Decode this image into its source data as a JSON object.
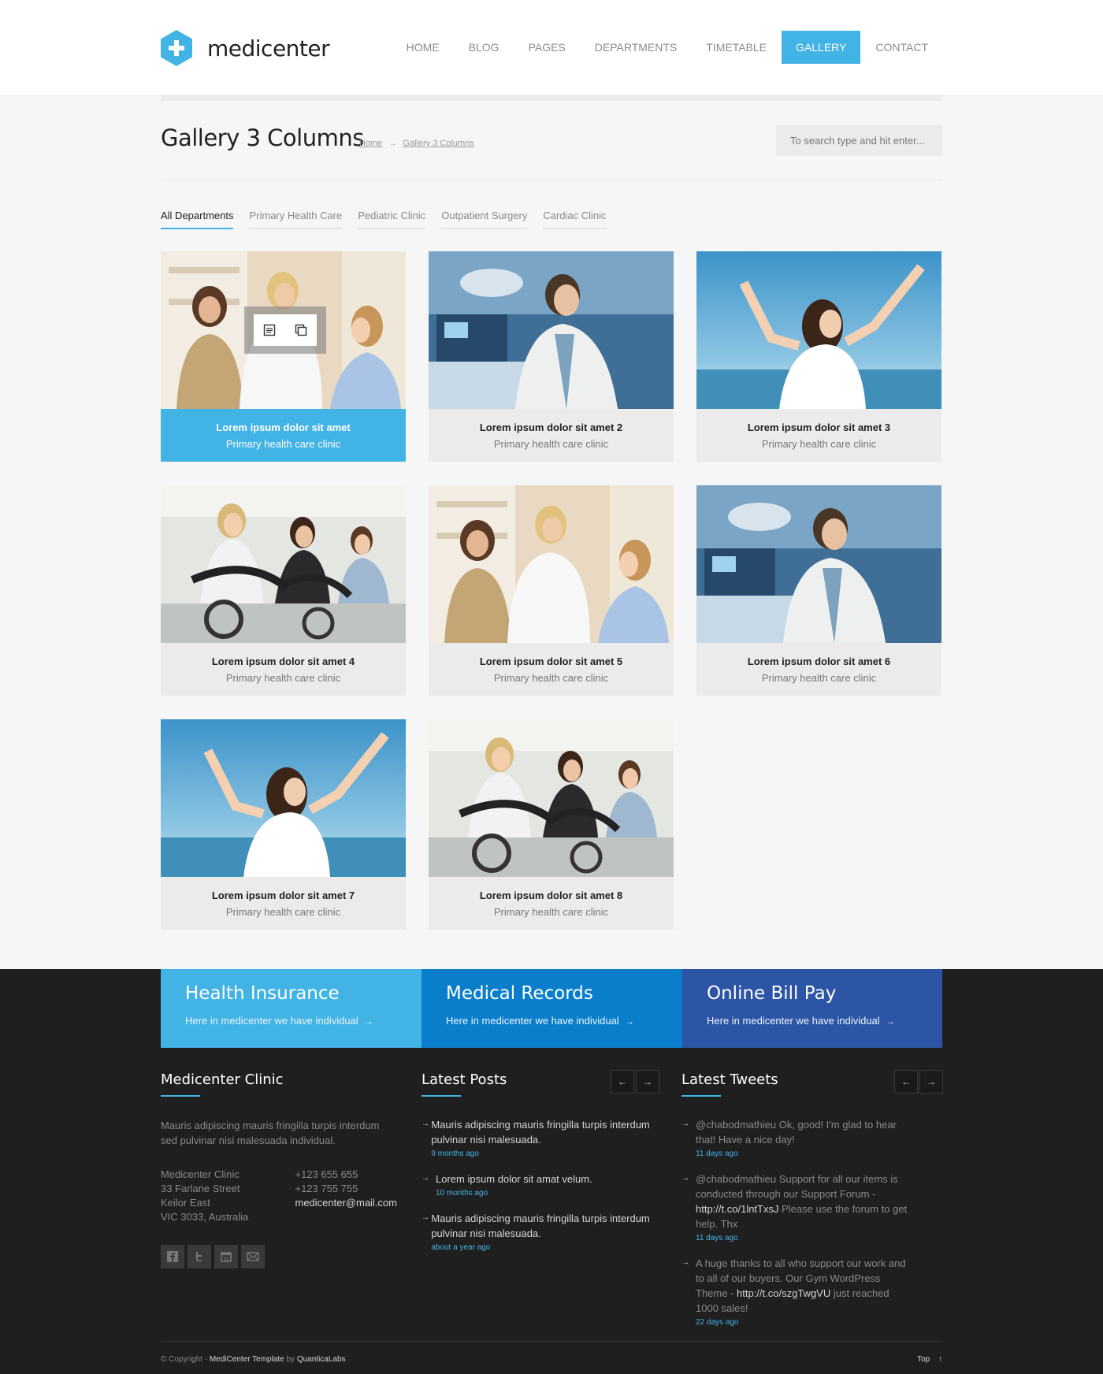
{
  "brand": {
    "name": "medicenter",
    "accent": "#42b3e5"
  },
  "nav": [
    "HOME",
    "BLOG",
    "PAGES",
    "DEPARTMENTS",
    "TIMETABLE",
    "GALLERY",
    "CONTACT"
  ],
  "nav_active": "GALLERY",
  "page": {
    "title": "Gallery 3 Columns",
    "breadcrumb": {
      "home": "Home",
      "sep": "→",
      "current": "Gallery 3 Columns"
    },
    "search_placeholder": "To search type and hit enter..."
  },
  "filters": [
    "All Departments",
    "Primary Health Care",
    "Pediatric Clinic",
    "Outpatient Surgery",
    "Cardiac Clinic"
  ],
  "filter_active": "All Departments",
  "gallery": [
    {
      "title": "Lorem ipsum dolor sit amet",
      "subtitle": "Primary health care clinic",
      "image": "doctor-child"
    },
    {
      "title": "Lorem ipsum dolor sit amet 2",
      "subtitle": "Primary health care clinic",
      "image": "surgeon"
    },
    {
      "title": "Lorem ipsum dolor sit amet 3",
      "subtitle": "Primary health care clinic",
      "image": "woman-sky"
    },
    {
      "title": "Lorem ipsum dolor sit amet 4",
      "subtitle": "Primary health care clinic",
      "image": "spinning"
    },
    {
      "title": "Lorem ipsum dolor sit amet 5",
      "subtitle": "Primary health care clinic",
      "image": "doctor-child"
    },
    {
      "title": "Lorem ipsum dolor sit amet 6",
      "subtitle": "Primary health care clinic",
      "image": "surgeon"
    },
    {
      "title": "Lorem ipsum dolor sit amet 7",
      "subtitle": "Primary health care clinic",
      "image": "woman-sky"
    },
    {
      "title": "Lorem ipsum dolor sit amet 8",
      "subtitle": "Primary health care clinic",
      "image": "spinning"
    }
  ],
  "footer": {
    "boxes": [
      {
        "title": "Health Insurance",
        "link": "Here in medicenter we have individual",
        "color": "#42b3e5"
      },
      {
        "title": "Medical Records",
        "link": "Here in medicenter we have individual",
        "color": "#0a7ecb"
      },
      {
        "title": "Online Bill Pay",
        "link": "Here in medicenter we have individual",
        "color": "#2d55a5"
      }
    ],
    "about": {
      "title": "Medicenter Clinic",
      "text": "Mauris adipiscing mauris fringilla turpis interdum sed pulvinar nisi malesuada individual.",
      "address": [
        "Medicenter Clinic",
        "33 Farlane Street",
        "Keilor East",
        "VIC 3033, Australia"
      ],
      "phones": [
        "+123 655 655",
        "+123 755 755"
      ],
      "email": "medicenter@mail.com",
      "social": [
        "facebook-icon",
        "twitter-icon",
        "calendar-icon",
        "mail-icon"
      ]
    },
    "posts": {
      "title": "Latest Posts",
      "items": [
        {
          "text": "Mauris adipiscing mauris fringilla turpis interdum pulvinar nisi malesuada.",
          "date": "9 months ago"
        },
        {
          "text": "Lorem ipsum dolor sit amat velum.",
          "date": "10 months ago"
        },
        {
          "text": "Mauris adipiscing mauris fringilla turpis interdum pulvinar nisi malesuada.",
          "date": "about a year ago"
        }
      ]
    },
    "tweets": {
      "title": "Latest Tweets",
      "items": [
        {
          "text": "@chabodmathieu Ok, good! I'm glad to hear that! Have a nice day!",
          "link": "",
          "text2": "",
          "date": "11 days ago"
        },
        {
          "text": "@chabodmathieu Support for all our items is conducted through our Support Forum - ",
          "link": "http://t.co/1lntTxsJ",
          "text2": " Please use the forum to get help. Thx",
          "date": "11 days ago"
        },
        {
          "text": "A huge thanks to all who support our work and to all of our buyers. Our Gym WordPress Theme - ",
          "link": "http://t.co/szgTwgVU",
          "text2": " just reached 1000 sales!",
          "date": "22 days ago"
        }
      ]
    },
    "copyright": {
      "prefix": "© Copyright - ",
      "product": "MediCenter Template",
      "by": " by ",
      "author": "QuanticaLabs"
    },
    "top": "Top",
    "arrow_prev": "←",
    "arrow_next": "→"
  }
}
